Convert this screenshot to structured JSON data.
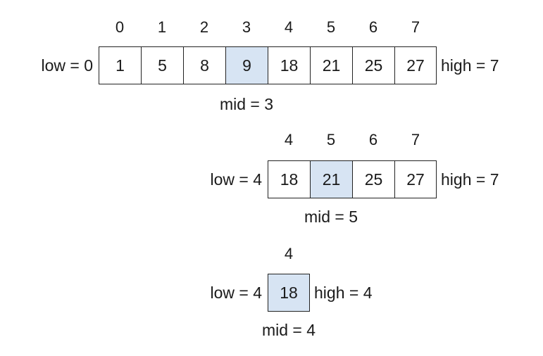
{
  "steps": [
    {
      "indices": [
        "0",
        "1",
        "2",
        "3",
        "4",
        "5",
        "6",
        "7"
      ],
      "values": [
        "1",
        "5",
        "8",
        "9",
        "18",
        "21",
        "25",
        "27"
      ],
      "highlight": 3,
      "low_label": "low = 0",
      "high_label": "high = 7",
      "mid_label": "mid = 3"
    },
    {
      "indices": [
        "4",
        "5",
        "6",
        "7"
      ],
      "values": [
        "18",
        "21",
        "25",
        "27"
      ],
      "highlight": 1,
      "low_label": "low = 4",
      "high_label": "high = 7",
      "mid_label": "mid = 5"
    },
    {
      "indices": [
        "4"
      ],
      "values": [
        "18"
      ],
      "highlight": 0,
      "low_label": "low = 4",
      "high_label": "high = 4",
      "mid_label": "mid = 4"
    }
  ],
  "colors": {
    "highlight": "#d7e4f3",
    "border": "#222222"
  }
}
